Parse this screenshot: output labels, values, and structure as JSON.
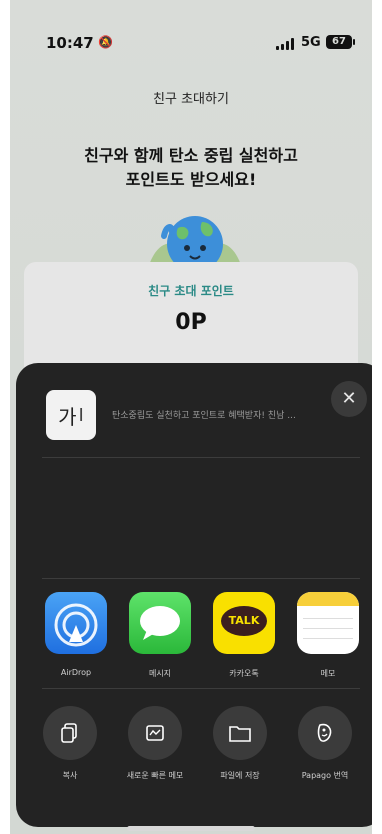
{
  "status": {
    "time": "10:47",
    "network": "5G",
    "battery": "67"
  },
  "page": {
    "title": "친구 초대하기",
    "headline_line1": "친구와 함께 탄소 중립 실천하고",
    "headline_line2": "포인트도 받으세요!",
    "card_label": "친구 초대 포인트",
    "points": "0P"
  },
  "share_sheet": {
    "thumb_text": "가",
    "preview_text": "탄소중립도 실천하고 포인트로 혜택받자! 친남 ...",
    "close_symbol": "✕",
    "apps": [
      {
        "label": "AirDrop",
        "icon": "airdrop-icon"
      },
      {
        "label": "메시지",
        "icon": "messages-icon"
      },
      {
        "label": "카카오톡",
        "icon": "kakaotalk-icon",
        "icon_text": "TALK"
      },
      {
        "label": "메모",
        "icon": "notes-icon"
      }
    ],
    "actions": [
      {
        "label": "복사",
        "icon": "copy-icon"
      },
      {
        "label": "새로운 빠른 메모",
        "icon": "quick-note-icon"
      },
      {
        "label": "파일에 저장",
        "icon": "folder-icon"
      },
      {
        "label": "Papago 번역",
        "icon": "papago-icon"
      }
    ]
  },
  "colors": {
    "accent": "#2b8a86",
    "sheet_bg": "#232323",
    "kakao": "#f9e000"
  }
}
